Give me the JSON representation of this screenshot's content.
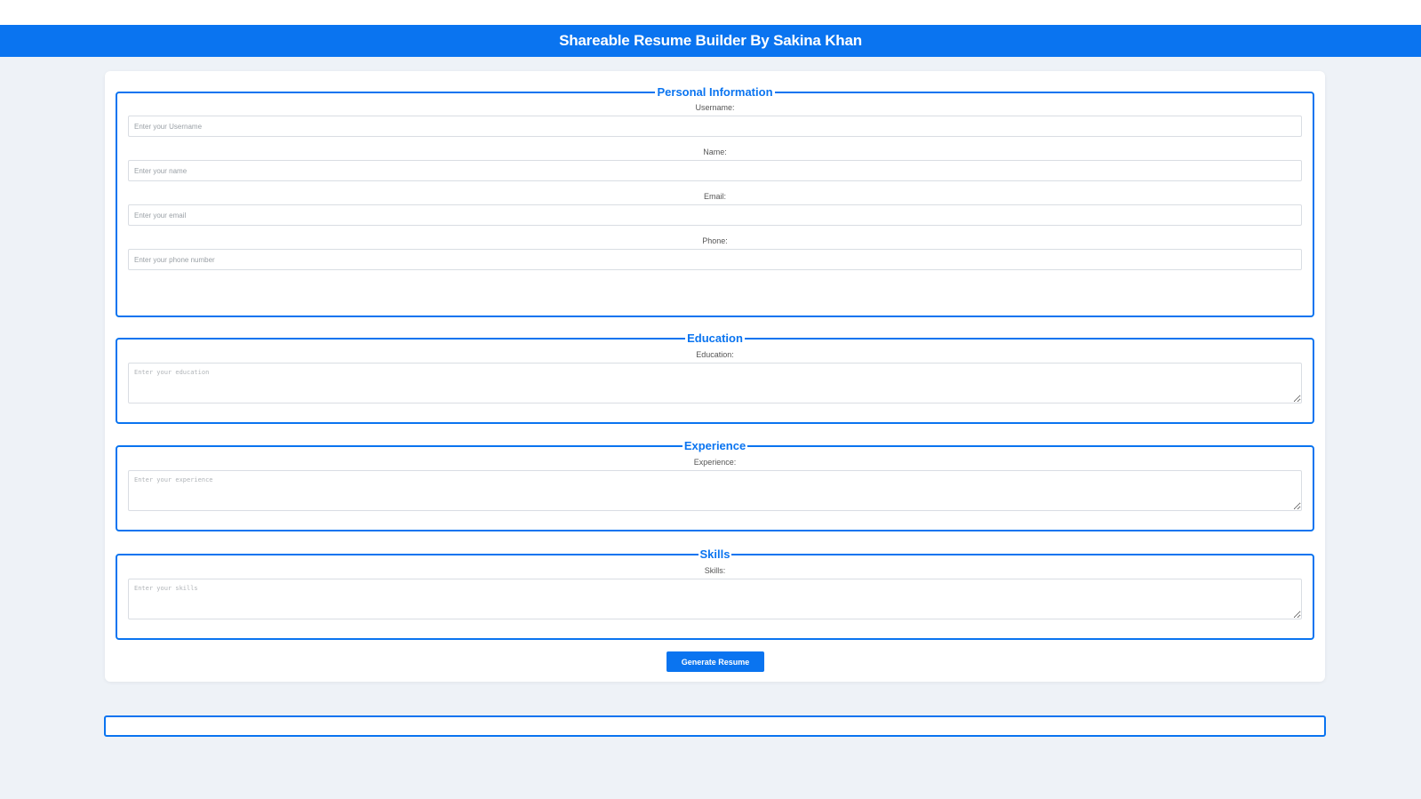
{
  "header": {
    "title": "Shareable Resume Builder By Sakina Khan"
  },
  "personal": {
    "legend": "Personal Information",
    "fields": [
      {
        "label": "Username:",
        "placeholder": "Enter your Username"
      },
      {
        "label": "Name:",
        "placeholder": "Enter your name"
      },
      {
        "label": "Email:",
        "placeholder": "Enter your email"
      },
      {
        "label": "Phone:",
        "placeholder": "Enter your phone number"
      }
    ]
  },
  "education": {
    "legend": "Education",
    "label": "Education:",
    "placeholder": "Enter your education"
  },
  "experience": {
    "legend": "Experience",
    "label": "Experience:",
    "placeholder": "Enter your experience"
  },
  "skills": {
    "legend": "Skills",
    "label": "Skills:",
    "placeholder": "Enter your skills"
  },
  "actions": {
    "generate_label": "Generate Resume"
  },
  "colors": {
    "accent": "#0a74f0",
    "background": "#eef2f7"
  }
}
